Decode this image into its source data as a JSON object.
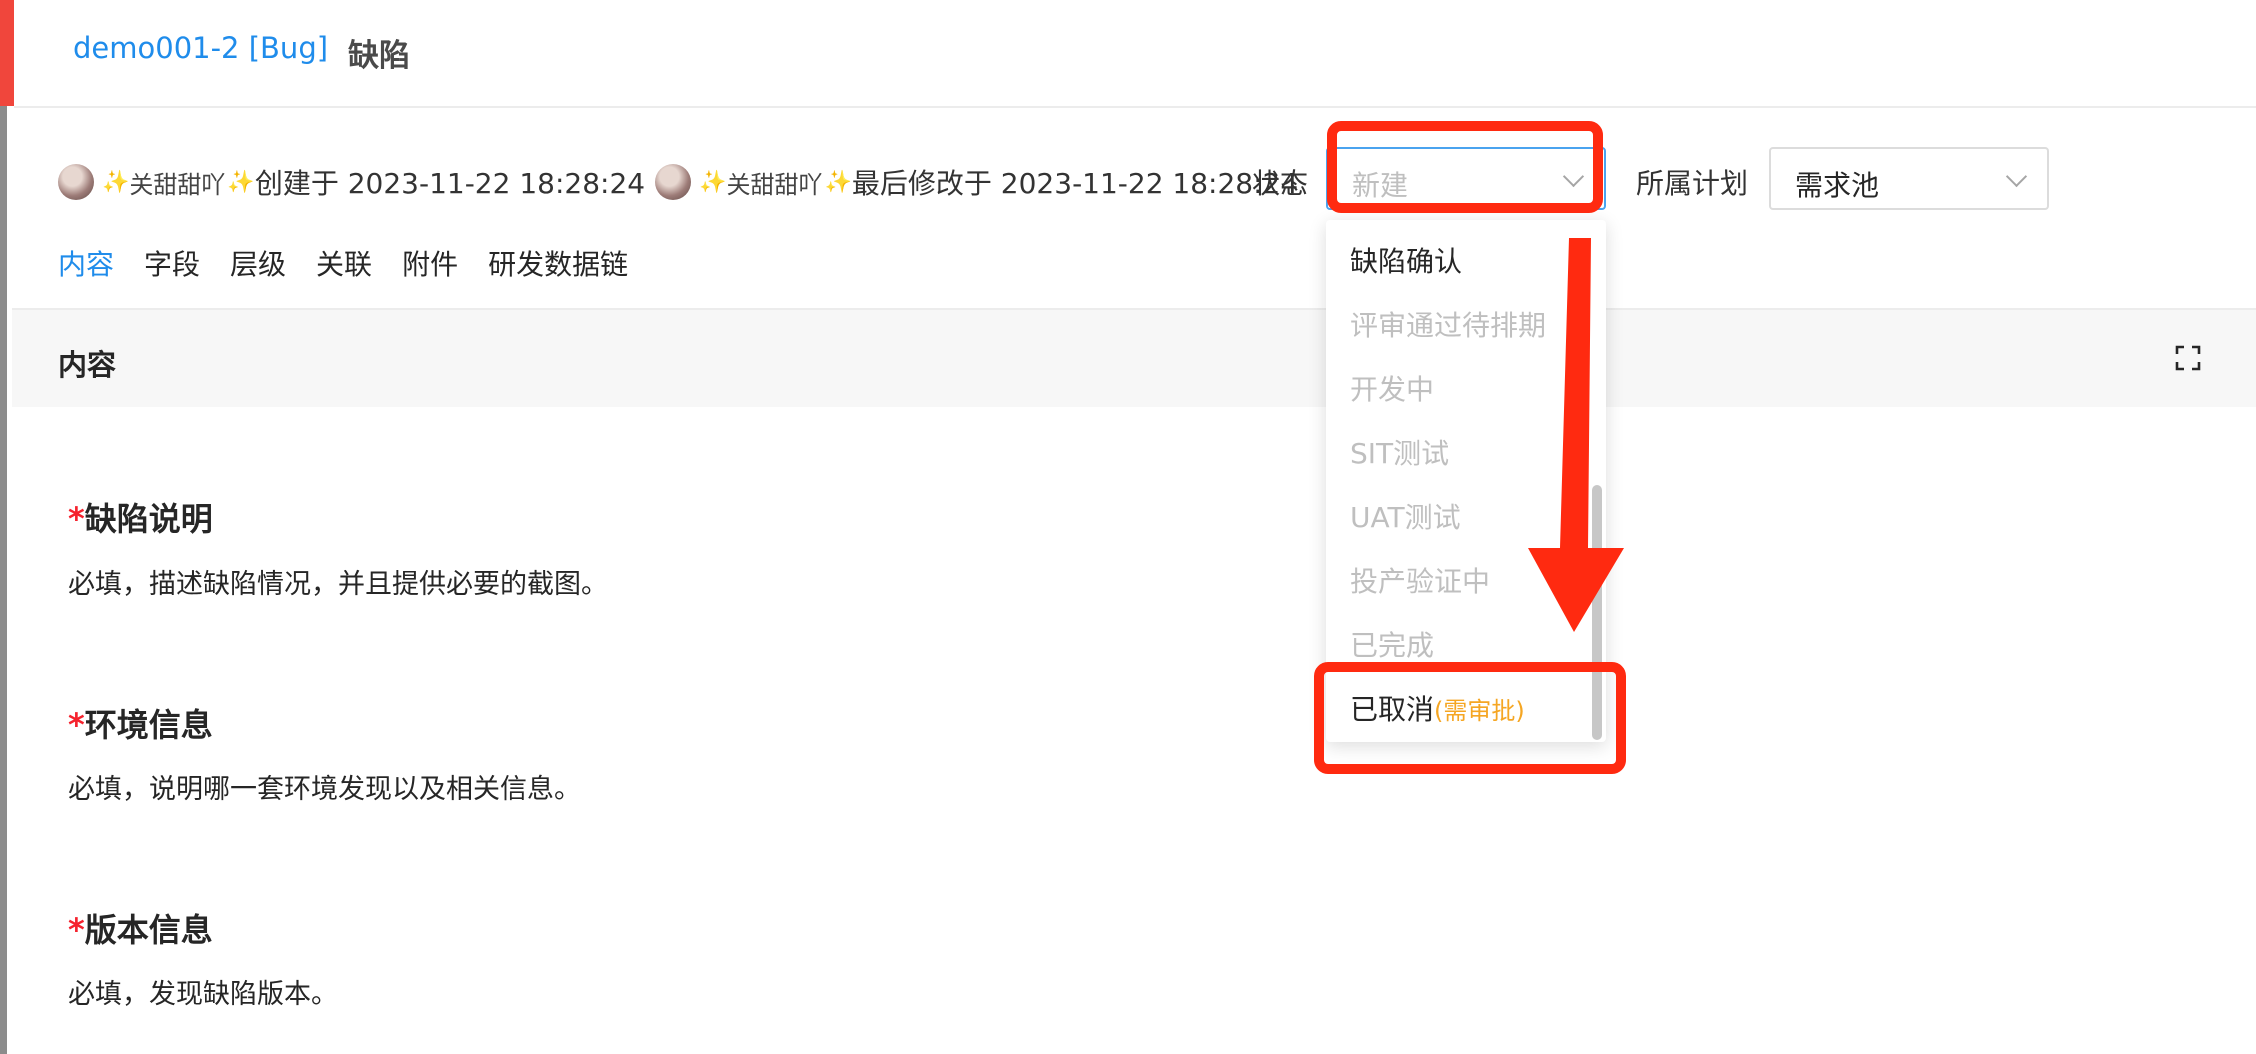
{
  "header": {
    "issue_id": "demo001-2 [Bug]",
    "issue_type": "缺陷"
  },
  "meta": {
    "creator": "关甜甜吖",
    "created_text": "创建于 2023-11-22 18:28:24",
    "modifier": "关甜甜吖",
    "modified_text": "最后修改于 2023-11-22 18:28:24",
    "crown_glyph": "✨"
  },
  "status": {
    "label": "状态",
    "value": "新建"
  },
  "plan": {
    "label": "所属计划",
    "value": "需求池"
  },
  "tabs": [
    "内容",
    "字段",
    "层级",
    "关联",
    "附件",
    "研发数据链"
  ],
  "section": {
    "title": "内容"
  },
  "fields": [
    {
      "required_mark": "*",
      "title": "缺陷说明",
      "desc": "必填，描述缺陷情况，并且提供必要的截图。"
    },
    {
      "required_mark": "*",
      "title": "环境信息",
      "desc": "必填，说明哪一套环境发现以及相关信息。"
    },
    {
      "required_mark": "*",
      "title": "版本信息",
      "desc": "必填，发现缺陷版本。"
    }
  ],
  "dropdown": {
    "options": [
      {
        "label": "缺陷确认",
        "enabled": true
      },
      {
        "label": "评审通过待排期",
        "enabled": false
      },
      {
        "label": "开发中",
        "enabled": false
      },
      {
        "label": "SIT测试",
        "enabled": false
      },
      {
        "label": "UAT测试",
        "enabled": false
      },
      {
        "label": "投产验证中",
        "enabled": false
      },
      {
        "label": "已完成",
        "enabled": false
      },
      {
        "label": "已取消",
        "note": "(需审批)",
        "enabled": true
      }
    ]
  },
  "colors": {
    "accent": "#1f8ceb",
    "highlight": "#ff2a10",
    "required": "#f5222d",
    "note": "#f5a623"
  }
}
